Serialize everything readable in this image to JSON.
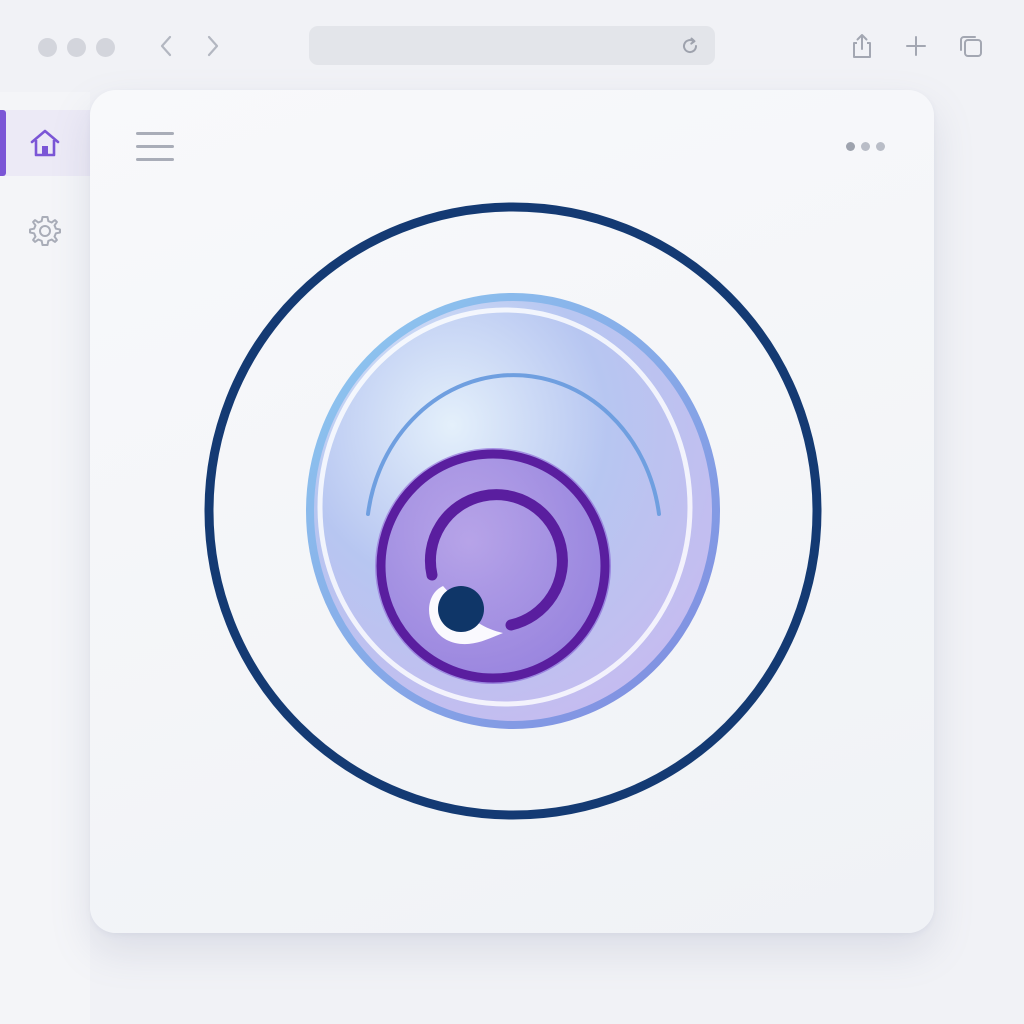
{
  "window": {
    "title_dots": [
      "close",
      "minimize",
      "maximize"
    ],
    "nav": {
      "back_icon": "chevron-left-icon",
      "forward_icon": "chevron-right-icon"
    },
    "address_bar": {
      "value": "",
      "reload_icon": "reload-icon"
    },
    "toolbar": {
      "share_icon": "share-icon",
      "new_tab_icon": "plus-icon",
      "tabs_icon": "tabs-icon"
    }
  },
  "sidebar": {
    "items": [
      {
        "icon": "home-icon",
        "active": true
      },
      {
        "icon": "gear-icon",
        "active": false
      }
    ],
    "accent": "#7b56d6"
  },
  "card": {
    "menu_icon": "hamburger-icon",
    "more_icon": "more-dots-icon"
  },
  "logo": {
    "outer_ring_color": "#143a73",
    "inner_gradient": [
      "#8cc4ee",
      "#a996e6",
      "#cfc3f2"
    ],
    "spiral_color": "#5a1e9f",
    "dot_color": "#0f3668"
  }
}
